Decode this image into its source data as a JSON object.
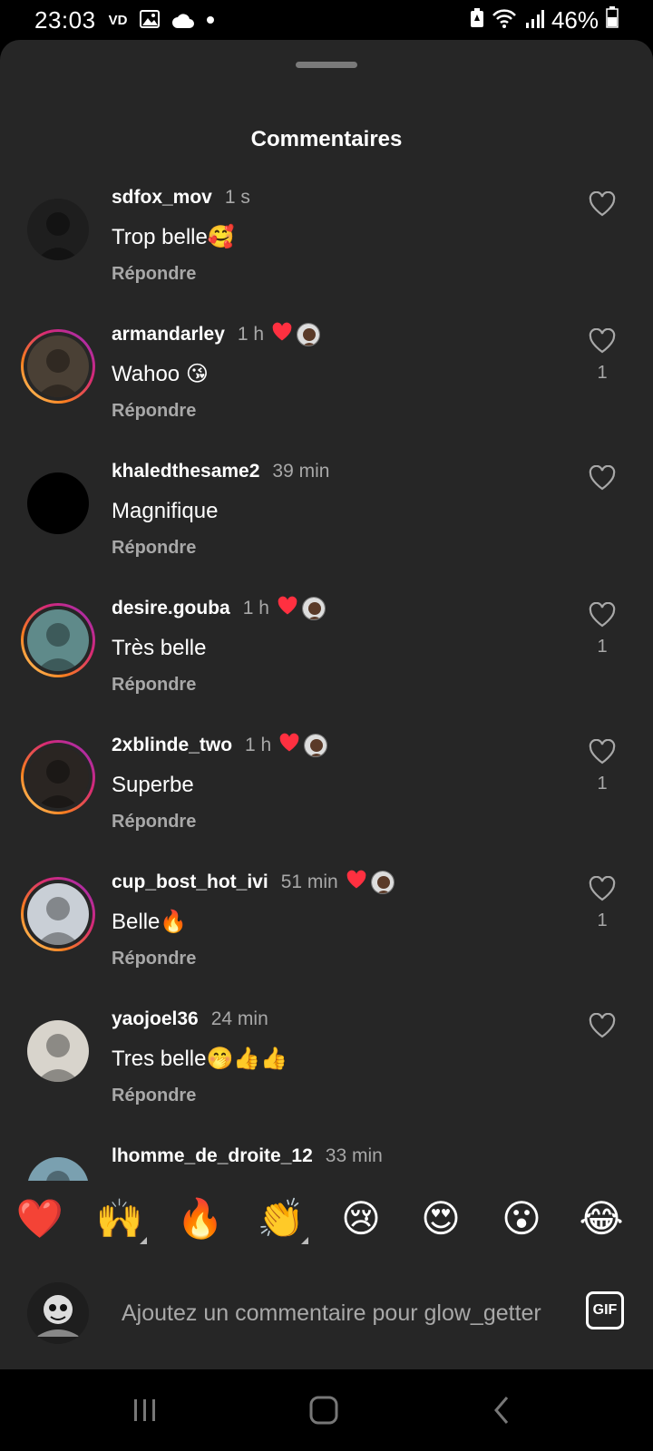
{
  "status_bar": {
    "time": "23:03",
    "vd": "VD",
    "battery": "46%"
  },
  "sheet": {
    "title": "Commentaires"
  },
  "comments": [
    {
      "username": "sdfox_mov",
      "time": "1 s",
      "text": "Trop belle🥰",
      "reply": "Répondre",
      "liked_by_author": false,
      "likes": "",
      "story_ring": false,
      "avatar_color": "#1e1e1e"
    },
    {
      "username": "armandarley",
      "time": "1 h",
      "text": "Wahoo 😘",
      "reply": "Répondre",
      "liked_by_author": true,
      "likes": "1",
      "story_ring": true,
      "avatar_color": "#4a4035"
    },
    {
      "username": "khaledthesame2",
      "time": "39 min",
      "text": "Magnifique",
      "reply": "Répondre",
      "liked_by_author": false,
      "likes": "",
      "story_ring": false,
      "avatar_color": "#000000"
    },
    {
      "username": "desire.gouba",
      "time": "1 h",
      "text": "Très belle",
      "reply": "Répondre",
      "liked_by_author": true,
      "likes": "1",
      "story_ring": true,
      "avatar_color": "#5f8a8a"
    },
    {
      "username": "2xblinde_two",
      "time": "1 h",
      "text": "Superbe",
      "reply": "Répondre",
      "liked_by_author": true,
      "likes": "1",
      "story_ring": true,
      "avatar_color": "#2a2522"
    },
    {
      "username": "cup_bost_hot_ivi",
      "time": "51 min",
      "text": "Belle🔥",
      "reply": "Répondre",
      "liked_by_author": true,
      "likes": "1",
      "story_ring": true,
      "avatar_color": "#c9cfd6"
    },
    {
      "username": "yaojoel36",
      "time": "24 min",
      "text": "Tres belle🤭👍👍",
      "reply": "Répondre",
      "liked_by_author": false,
      "likes": "",
      "story_ring": false,
      "avatar_color": "#d8d4cc"
    },
    {
      "username": "lhomme_de_droite_12",
      "time": "33 min",
      "text": "",
      "reply": "",
      "liked_by_author": false,
      "likes": "",
      "story_ring": false,
      "avatar_color": "#7aa0b0"
    }
  ],
  "emoji_bar": [
    "❤️",
    "🙌",
    "🔥",
    "👏",
    "😢",
    "😍",
    "😮",
    "😂"
  ],
  "input": {
    "placeholder": "Ajoutez un commentaire pour glow_getter"
  },
  "gif_label": "GIF",
  "colors": {
    "sheet_bg": "#262626",
    "muted_text": "#a8a8a8",
    "heart_red": "#ff3040"
  }
}
